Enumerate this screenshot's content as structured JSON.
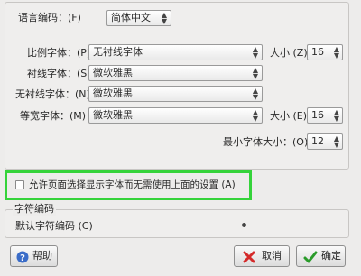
{
  "encoding_row": {
    "label": "语言编码：(F)",
    "value": "简体中文"
  },
  "fonts": {
    "proportional": {
      "label": "比例字体：(P)",
      "value": "无衬线字体"
    },
    "size_label": "大小 (Z):",
    "size_value": "16",
    "serif": {
      "label": "衬线字体：(S)",
      "value": "微软雅黑"
    },
    "sans_serif": {
      "label": "无衬线字体：(N)",
      "value": "微软雅黑"
    },
    "monospace": {
      "label": "等宽字体：(M)",
      "value": "微软雅黑"
    },
    "mono_size_label": "大小 (E):",
    "mono_size_value": "16",
    "min_size_label": "最小字体大小：(O)",
    "min_size_value": "12"
  },
  "allow_pages_checkbox": {
    "label": "允许页面选择显示字体而无需使用上面的设置 (A)",
    "checked": false
  },
  "charset": {
    "group_title": "字符编码",
    "default_label": "默认字符编码 (C)",
    "default_value": ""
  },
  "buttons": {
    "help": "帮助",
    "cancel": "取消",
    "ok": "确定"
  },
  "colors": {
    "highlight": "#35d33a",
    "cancel_icon": "#d42a2a",
    "ok_icon": "#2a9b2a",
    "help_icon": "#3a6cc8"
  }
}
